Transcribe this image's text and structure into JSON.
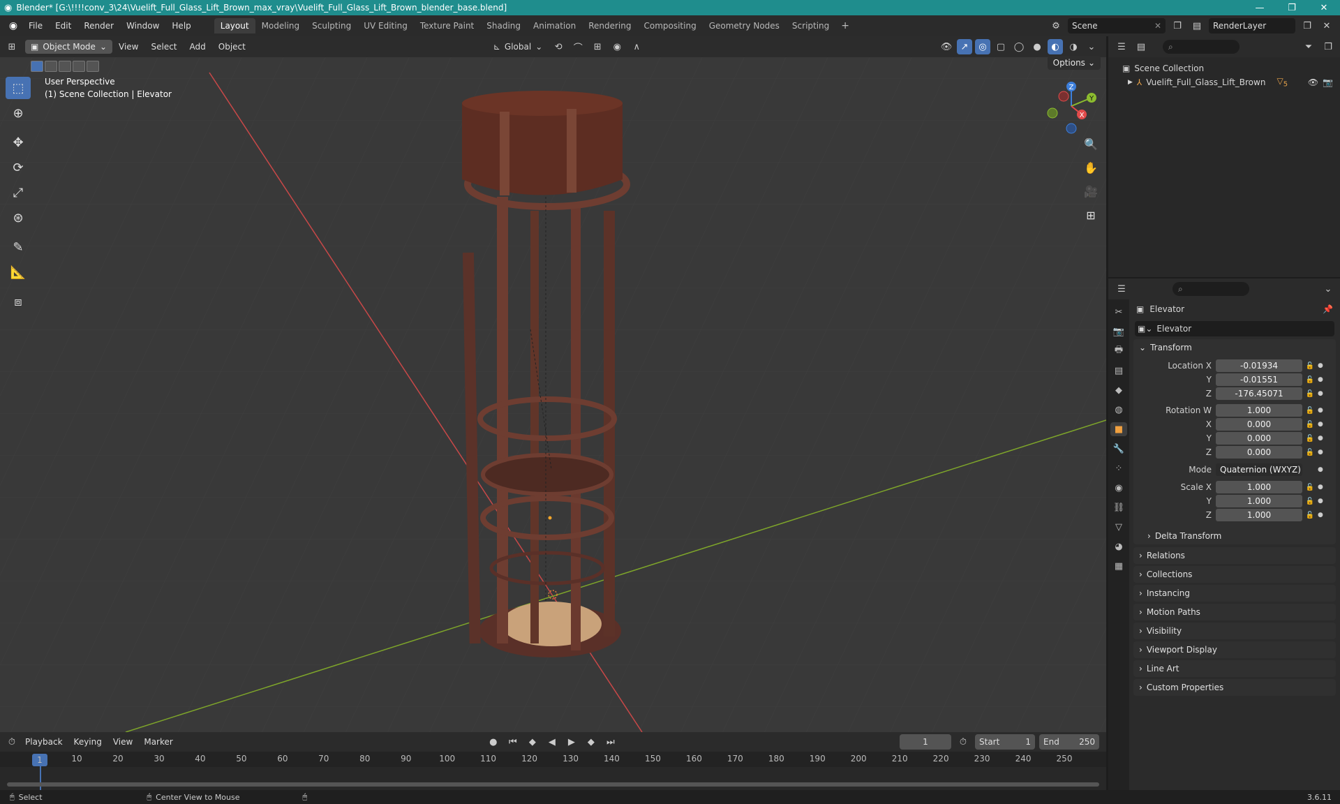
{
  "title": {
    "text": "Blender* [G:\\!!!!conv_3\\24\\Vuelift_Full_Glass_Lift_Brown_max_vray\\Vuelift_Full_Glass_Lift_Brown_blender_base.blend]",
    "icon": "blender-logo-icon"
  },
  "menus": [
    "File",
    "Edit",
    "Render",
    "Window",
    "Help"
  ],
  "workspaces": [
    "Layout",
    "Modeling",
    "Sculpting",
    "UV Editing",
    "Texture Paint",
    "Shading",
    "Animation",
    "Rendering",
    "Compositing",
    "Geometry Nodes",
    "Scripting"
  ],
  "active_workspace": "Layout",
  "scene": {
    "name": "Scene",
    "view_layer": "RenderLayer"
  },
  "viewport": {
    "mode": "Object Mode",
    "menus": [
      "View",
      "Select",
      "Add",
      "Object"
    ],
    "orientation": "Global",
    "options_label": "Options",
    "info_line1": "User Perspective",
    "info_line2": "(1) Scene Collection | Elevator",
    "gizmo": {
      "x": "X",
      "y": "Y",
      "z": "Z"
    }
  },
  "outliner": {
    "root": "Scene Collection",
    "items": [
      {
        "name": "Vuelift_Full_Glass_Lift_Brown",
        "badge": "5"
      }
    ]
  },
  "properties": {
    "object_name": "Elevator",
    "data_name": "Elevator",
    "transform": {
      "title": "Transform",
      "location": {
        "label": "Location X",
        "x": "-0.01934",
        "y": "-0.01551",
        "z": "-176.45071"
      },
      "rotation": {
        "label": "Rotation W",
        "w": "1.000",
        "x": "0.000",
        "y": "0.000",
        "z": "0.000"
      },
      "mode_label": "Mode",
      "mode": "Quaternion (WXYZ)",
      "scale": {
        "label": "Scale X",
        "x": "1.000",
        "y": "1.000",
        "z": "1.000"
      },
      "axis_y": "Y",
      "axis_z": "Z",
      "axis_x": "X",
      "delta": "Delta Transform"
    },
    "panels": [
      "Relations",
      "Collections",
      "Instancing",
      "Motion Paths",
      "Visibility",
      "Viewport Display",
      "Line Art",
      "Custom Properties"
    ]
  },
  "timeline": {
    "menus": [
      "Playback",
      "Keying",
      "View",
      "Marker"
    ],
    "current_frame": "1",
    "start_label": "Start",
    "start": "1",
    "end_label": "End",
    "end": "250",
    "ticks": [
      "1",
      "10",
      "20",
      "30",
      "40",
      "50",
      "60",
      "70",
      "80",
      "90",
      "100",
      "110",
      "120",
      "130",
      "140",
      "150",
      "160",
      "170",
      "180",
      "190",
      "200",
      "210",
      "220",
      "230",
      "240",
      "250"
    ]
  },
  "status": {
    "select": "Select",
    "center": "Center View to Mouse",
    "version": "3.6.11"
  },
  "colors": {
    "accent": "#4772b3",
    "titlebar": "#1f8d8d",
    "x_axis": "#e24b4b",
    "y_axis": "#8cbc2f",
    "z_axis": "#3d7fdb",
    "active_tab": "#f0a040"
  }
}
